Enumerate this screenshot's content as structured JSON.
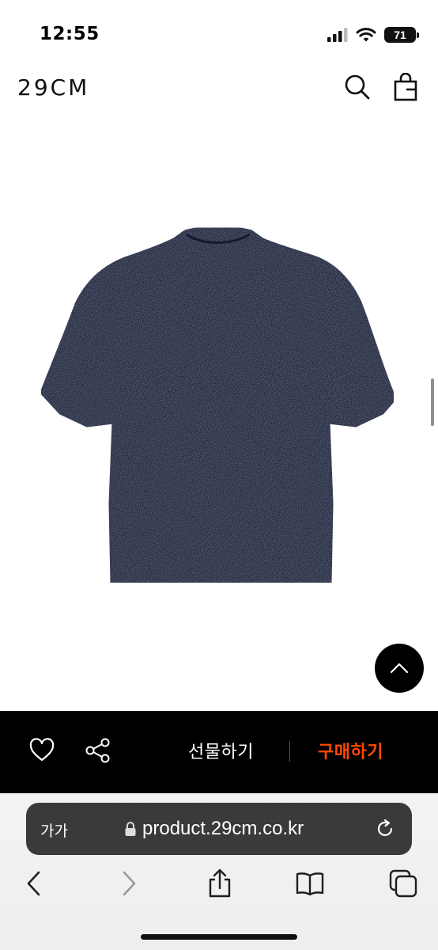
{
  "status_bar": {
    "time": "12:55",
    "battery": "71"
  },
  "header": {
    "logo": "29CM"
  },
  "product": {
    "image_alt": "navy knit short sleeve shirt back view"
  },
  "action_bar": {
    "gift_label": "선물하기",
    "buy_label": "구매하기",
    "buy_color": "#ff4800"
  },
  "browser": {
    "reader_label": "가가",
    "url": "product.29cm.co.kr"
  },
  "icons": [
    "signal-icon",
    "wifi-icon",
    "battery-icon",
    "search-icon",
    "shopping-bag-icon",
    "scroll-to-top-icon",
    "heart-icon",
    "share-icon",
    "lock-icon",
    "reload-icon",
    "back-icon",
    "forward-icon",
    "share-sheet-icon",
    "bookmarks-icon",
    "tabs-icon"
  ]
}
